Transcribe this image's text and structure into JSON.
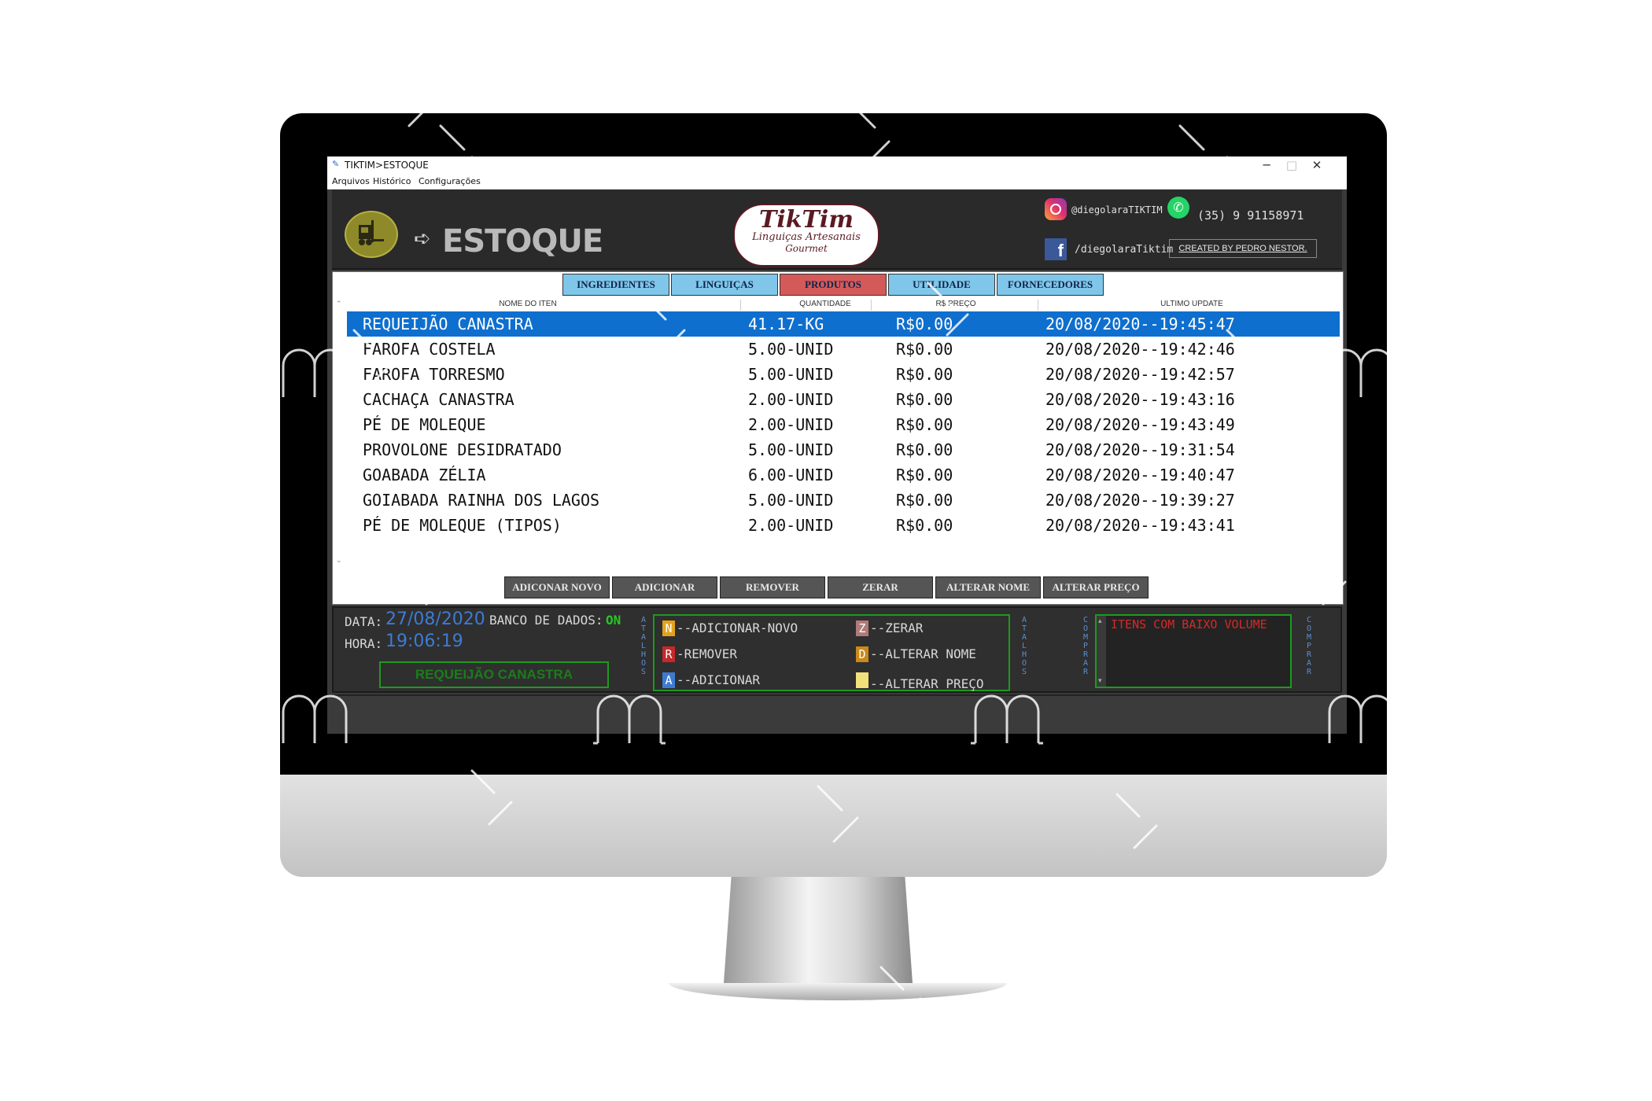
{
  "window": {
    "title": "TIKTIM>ESTOQUE",
    "controls": {
      "minimize": "─",
      "maximize": "□",
      "close": "✕"
    }
  },
  "menu": [
    "Arquivos",
    "Histórico",
    "Configurações"
  ],
  "header": {
    "title": "ESTOQUE",
    "arrow_icon": "arrow-right-icon",
    "logo": {
      "name": "TikTim",
      "line1": "Linguiças Artesanais",
      "line2": "Gourmet"
    },
    "instagram": "@diegolaraTIKTIM",
    "whatsapp": "(35) 9 91158971",
    "facebook": "/diegolaraTiktim",
    "credit": "CREATED BY PEDRO NESTOR."
  },
  "tabs": [
    {
      "label": "INGREDIENTES",
      "active": false
    },
    {
      "label": "LINGUIÇAS",
      "active": false
    },
    {
      "label": "PRODUTOS",
      "active": true
    },
    {
      "label": "UTILIDADE",
      "active": false
    },
    {
      "label": "FORNECEDORES",
      "active": false
    }
  ],
  "table": {
    "columns": [
      "NOME DO ITEN",
      "QUANTIDADE",
      "R$ PREÇO",
      "ULTIMO UPDATE"
    ],
    "rows": [
      {
        "name": "REQUEIJÃO CANASTRA",
        "qty": "41.17-KG",
        "price": "R$0.00",
        "updated": "20/08/2020--19:45:47"
      },
      {
        "name": "FAROFA COSTELA",
        "qty": "5.00-UNID",
        "price": "R$0.00",
        "updated": "20/08/2020--19:42:46"
      },
      {
        "name": "FAROFA TORRESMO",
        "qty": "5.00-UNID",
        "price": "R$0.00",
        "updated": "20/08/2020--19:42:57"
      },
      {
        "name": "CACHAÇA CANASTRA",
        "qty": "2.00-UNID",
        "price": "R$0.00",
        "updated": "20/08/2020--19:43:16"
      },
      {
        "name": "PÉ DE MOLEQUE",
        "qty": "2.00-UNID",
        "price": "R$0.00",
        "updated": "20/08/2020--19:43:49"
      },
      {
        "name": "PROVOLONE DESIDRATADO",
        "qty": "5.00-UNID",
        "price": "R$0.00",
        "updated": "20/08/2020--19:31:54"
      },
      {
        "name": "GOABADA ZÉLIA",
        "qty": "6.00-UNID",
        "price": "R$0.00",
        "updated": "20/08/2020--19:40:47"
      },
      {
        "name": "GOIABADA RAINHA DOS LAGOS",
        "qty": "5.00-UNID",
        "price": "R$0.00",
        "updated": "20/08/2020--19:39:27"
      },
      {
        "name": "PÉ DE MOLEQUE (TIPOS)",
        "qty": "2.00-UNID",
        "price": "R$0.00",
        "updated": "20/08/2020--19:43:41"
      }
    ],
    "selected_row": 0
  },
  "actions": [
    "ADICONAR NOVO",
    "ADICIONAR",
    "REMOVER",
    "ZERAR",
    "ALTERAR NOME",
    "ALTERAR PREÇO"
  ],
  "status": {
    "date_label": "DATA:",
    "date": "27/08/2020",
    "db_label": "BANCO DE DADOS:",
    "db_status": "ON",
    "time_label": "HORA:",
    "time": "19:06:19",
    "selected_item": "REQUEIJÃO CANASTRA",
    "side_label_atalhos": "ATALHOS",
    "side_label_comprar": "COMPRAR",
    "low_stock_title": "ITENS COM BAIXO VOLUME"
  },
  "shortcuts": [
    {
      "key": "N",
      "label": "--ADICIONAR-NOVO",
      "color": "#e5a21a"
    },
    {
      "key": "R",
      "label": "-REMOVER",
      "color": "#c62828"
    },
    {
      "key": "A",
      "label": "--ADICIONAR",
      "color": "#3d7bd3"
    },
    {
      "key": "Z",
      "label": "--ZERAR",
      "color": "#b07a7a"
    },
    {
      "key": "D",
      "label": "--ALTERAR NOME",
      "color": "#c98a1a"
    },
    {
      "key": "",
      "label": "--ALTERAR PREÇO",
      "color": "#f2e07a"
    }
  ],
  "colors": {
    "accent_blue": "#0e6fce",
    "tab_blue": "#7fc6ea",
    "tab_active": "#d45a5a",
    "status_green": "#1d9a1d",
    "alert_red": "#d62828"
  }
}
